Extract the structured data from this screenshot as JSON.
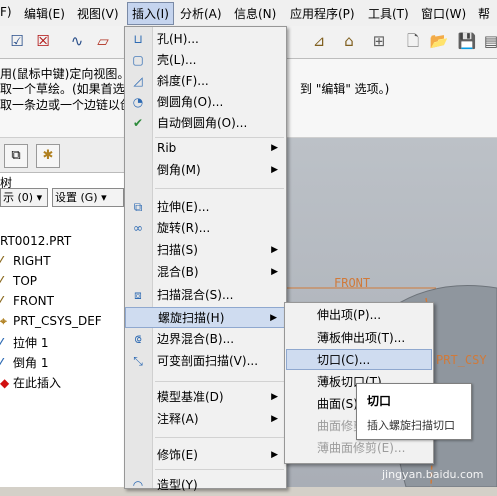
{
  "menubar": {
    "items": [
      "F)",
      "编辑(E)",
      "视图(V)",
      "插入(I)",
      "分析(A)",
      "信息(N)",
      "应用程序(P)",
      "工具(T)",
      "窗口(W)",
      "帮"
    ],
    "active_index": 3
  },
  "message": {
    "line1": "用(鼠标中键)定向视图。选",
    "line2": "取一个草绘。(如果首选内",
    "line3": "取一条边或一个边链以创",
    "line2_right": "到 \"编辑\" 选项。)"
  },
  "left_panel": {
    "label_tree": "树",
    "display_combo": "示 (0) ▾",
    "settings_combo": "设置 (G) ▾",
    "tree": [
      {
        "label": "RT0012.PRT",
        "icon": ""
      },
      {
        "label": "RIGHT",
        "icon": "datum-plane-icon"
      },
      {
        "label": "TOP",
        "icon": "datum-plane-icon"
      },
      {
        "label": "FRONT",
        "icon": "datum-plane-icon"
      },
      {
        "label": "PRT_CSYS_DEF",
        "icon": "csys-icon"
      },
      {
        "label": "拉伸 1",
        "icon": "extrude-icon"
      },
      {
        "label": "倒角 1",
        "icon": "chamfer-icon"
      },
      {
        "label": "在此插入",
        "icon": "insert-here-icon"
      }
    ]
  },
  "viewport": {
    "label_front": "FRONT",
    "label_csys": "PRT_CSY"
  },
  "insert_menu": {
    "items": [
      {
        "label": "孔(H)...",
        "icon": "hole-icon",
        "arrow": false
      },
      {
        "label": "壳(L)...",
        "icon": "shell-icon",
        "arrow": false
      },
      {
        "label": "斜度(F)...",
        "icon": "draft-icon",
        "arrow": false
      },
      {
        "label": "倒圆角(O)...",
        "icon": "round-icon",
        "arrow": false
      },
      {
        "label": "自动倒圆角(O)...",
        "icon": "auto-round-icon",
        "arrow": false
      },
      {
        "label": "Rib",
        "icon": "",
        "arrow": true
      },
      {
        "label": "倒角(M)",
        "icon": "",
        "arrow": true
      },
      {
        "label": "拉伸(E)...",
        "icon": "extrude-icon",
        "arrow": false
      },
      {
        "label": "旋转(R)...",
        "icon": "revolve-icon",
        "arrow": false
      },
      {
        "label": "扫描(S)",
        "icon": "",
        "arrow": true
      },
      {
        "label": "混合(B)",
        "icon": "",
        "arrow": true
      },
      {
        "label": "扫描混合(S)...",
        "icon": "swept-blend-icon",
        "arrow": false
      },
      {
        "label": "螺旋扫描(H)",
        "icon": "",
        "arrow": true
      },
      {
        "label": "边界混合(B)...",
        "icon": "boundary-blend-icon",
        "arrow": false
      },
      {
        "label": "可变剖面扫描(V)...",
        "icon": "variable-sweep-icon",
        "arrow": false
      },
      {
        "label": "模型基准(D)",
        "icon": "",
        "arrow": true
      },
      {
        "label": "注释(A)",
        "icon": "",
        "arrow": true
      },
      {
        "label": "修饰(E)",
        "icon": "",
        "arrow": true
      },
      {
        "label": "造型(Y)",
        "icon": "",
        "arrow": false
      }
    ]
  },
  "helical_submenu": {
    "items": [
      {
        "label": "伸出项(P)...",
        "disabled": false
      },
      {
        "label": "薄板伸出项(T)...",
        "disabled": false
      },
      {
        "label": "切口(C)...",
        "disabled": false
      },
      {
        "label": "薄板切口(T)...",
        "disabled": false
      },
      {
        "label": "曲面(S)...",
        "disabled": false
      },
      {
        "label": "曲面修剪(F)...",
        "disabled": true
      },
      {
        "label": "薄曲面修剪(E)...",
        "disabled": true
      }
    ]
  },
  "tooltip": {
    "title": "切口",
    "description": "插入螺旋扫描切口"
  },
  "watermark": "jingyan.baidu.com",
  "colors": {
    "menu_highlight": "#cfdcf0",
    "menu_highlight_border": "#8fa8cf",
    "viewport_bg": "#b3b8bf",
    "model_orange": "#d07a3a",
    "insert_marker_red": "#d01010"
  }
}
